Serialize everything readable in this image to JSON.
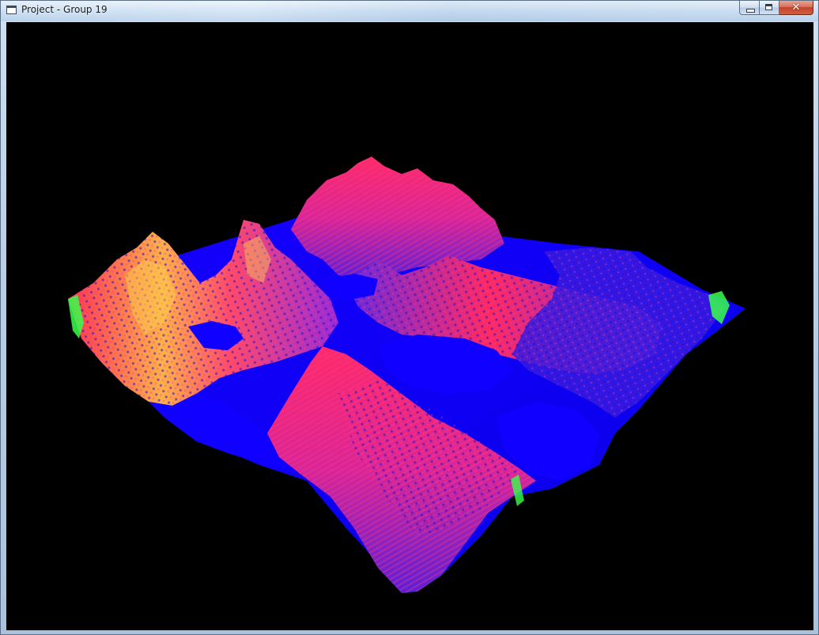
{
  "window": {
    "title": "Project - Group 19",
    "buttons": {
      "minimize_icon": "minimize-icon",
      "maximize_icon": "maximize-icon",
      "close_icon": "close-icon"
    }
  },
  "viewport": {
    "background": "#000000",
    "content": "terrain-heightmap-render",
    "colors": {
      "water": "#0a00ff",
      "peak_red": "#ff1e5a",
      "slope_magenta": "#c81ef0",
      "ridge_green": "#37ff4b",
      "ridge_yellow": "#ffc83c"
    }
  }
}
